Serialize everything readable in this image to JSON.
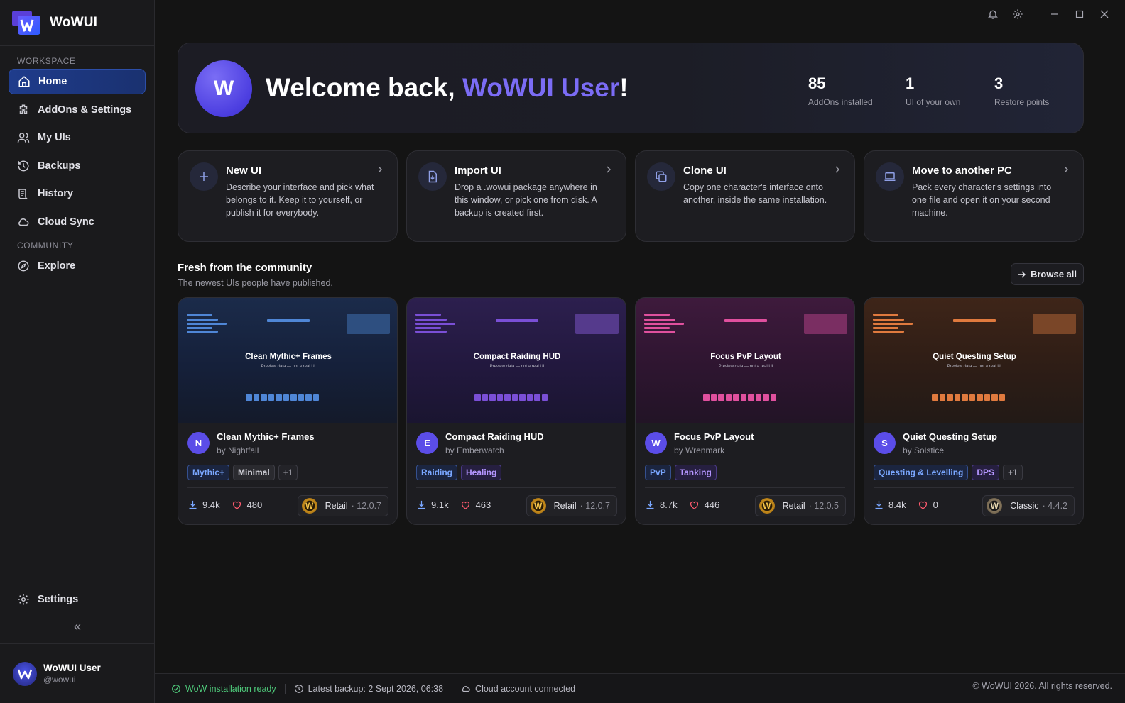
{
  "app": {
    "name": "WoWUI"
  },
  "sidebar": {
    "section_workspace": "WORKSPACE",
    "section_community": "COMMUNITY",
    "items": [
      {
        "label": "Home",
        "icon": "home-icon",
        "active": true
      },
      {
        "label": "AddOns & Settings",
        "icon": "puzzle-icon"
      },
      {
        "label": "My UIs",
        "icon": "users-icon"
      },
      {
        "label": "Backups",
        "icon": "history-icon"
      },
      {
        "label": "History",
        "icon": "scroll-icon"
      },
      {
        "label": "Cloud Sync",
        "icon": "cloud-icon"
      }
    ],
    "community_items": [
      {
        "label": "Explore",
        "icon": "compass-icon"
      }
    ],
    "settings_label": "Settings",
    "collapse_glyph": "«",
    "user": {
      "name": "WoWUI User",
      "handle": "@wowui"
    }
  },
  "hero": {
    "avatar_letter": "W",
    "greeting": "Welcome back, ",
    "user_name": "WoWUI User",
    "exclaim": "!",
    "stats": [
      {
        "value": "85",
        "label": "AddOns installed"
      },
      {
        "value": "1",
        "label": "UI of your own"
      },
      {
        "value": "3",
        "label": "Restore points"
      }
    ]
  },
  "actions": [
    {
      "title": "New UI",
      "desc": "Describe your interface and pick what belongs to it. Keep it to yourself, or publish it for everybody.",
      "icon": "plus-icon"
    },
    {
      "title": "Import UI",
      "desc": "Drop a .wowui package anywhere in this window, or pick one from disk. A backup is created first.",
      "icon": "file-import-icon"
    },
    {
      "title": "Clone UI",
      "desc": "Copy one character's interface onto another, inside the same installation.",
      "icon": "copy-icon"
    },
    {
      "title": "Move to another PC",
      "desc": "Pack every character's settings into one file and open it on your second machine.",
      "icon": "laptop-icon"
    }
  ],
  "community": {
    "title": "Fresh from the community",
    "subtitle": "The newest UIs people have published.",
    "browse_label": "Browse all",
    "preview_note": "Preview data — not a real UI",
    "cards": [
      {
        "name": "Clean Mythic+ Frames",
        "author": "by Nightfall",
        "avatar": "N",
        "tags": [
          {
            "label": "Mythic+",
            "style": "blue"
          },
          {
            "label": "Minimal",
            "style": "gray"
          },
          {
            "label": "+1",
            "style": "more"
          }
        ],
        "downloads": "9.4k",
        "likes": "480",
        "flavor": "Retail",
        "version": "· 12.0.7",
        "logo": "W",
        "theme": "blue"
      },
      {
        "name": "Compact Raiding HUD",
        "author": "by Emberwatch",
        "avatar": "E",
        "tags": [
          {
            "label": "Raiding",
            "style": "blue"
          },
          {
            "label": "Healing",
            "style": "purple"
          }
        ],
        "downloads": "9.1k",
        "likes": "463",
        "flavor": "Retail",
        "version": "· 12.0.7",
        "logo": "W",
        "theme": "purple"
      },
      {
        "name": "Focus PvP Layout",
        "author": "by Wrenmark",
        "avatar": "W",
        "tags": [
          {
            "label": "PvP",
            "style": "blue"
          },
          {
            "label": "Tanking",
            "style": "purple"
          }
        ],
        "downloads": "8.7k",
        "likes": "446",
        "flavor": "Retail",
        "version": "· 12.0.5",
        "logo": "W",
        "theme": "pink"
      },
      {
        "name": "Quiet Questing Setup",
        "author": "by Solstice",
        "avatar": "S",
        "tags": [
          {
            "label": "Questing & Levelling",
            "style": "blue"
          },
          {
            "label": "DPS",
            "style": "purple"
          },
          {
            "label": "+1",
            "style": "more"
          }
        ],
        "downloads": "8.4k",
        "likes": "0",
        "flavor": "Classic",
        "version": "· 4.4.2",
        "logo": "W",
        "theme": "orange"
      }
    ]
  },
  "themes": {
    "blue": {
      "bg": "linear-gradient(180deg,#1b2b4a 0%,#15203a 55%,#141a2a 100%)",
      "accent": "#4f86d6",
      "box": "#2e4f80"
    },
    "purple": {
      "bg": "linear-gradient(180deg,#2c1f4e 0%,#22183e 55%,#1a1530 100%)",
      "accent": "#7a4fd6",
      "box": "#553a8c"
    },
    "pink": {
      "bg": "linear-gradient(180deg,#3e1a3c 0%,#2e1530 55%,#221426 100%)",
      "accent": "#e0509e",
      "box": "#7a2e62"
    },
    "orange": {
      "bg": "linear-gradient(180deg,#3e2518 0%,#2e1d16 55%,#221a16 100%)",
      "accent": "#e07a3e",
      "box": "#7a4628"
    }
  },
  "statusbar": {
    "install": "WoW installation ready",
    "backup": "Latest backup: 2 Sept 2026, 06:38",
    "cloud": "Cloud account connected",
    "copyright": "© WoWUI 2026. All rights reserved."
  }
}
